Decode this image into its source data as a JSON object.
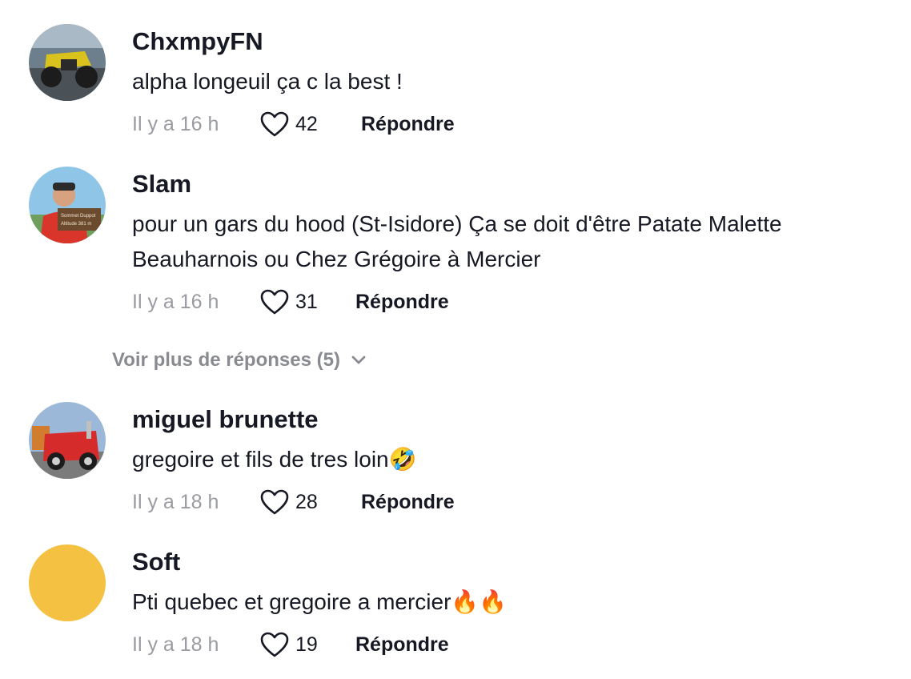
{
  "comments": [
    {
      "username": "ChxmpyFN",
      "text": "alpha longeuil ça c la best !",
      "time": "Il y a 16 h",
      "likes": "42",
      "reply": "Répondre",
      "avatar_color": "#5a6a78"
    },
    {
      "username": "Slam",
      "text": "pour un gars du hood (St-Isidore) Ça se doit d'être Patate Malette Beauharnois ou Chez Grégoire à Mercier",
      "time": "Il y a 16 h",
      "likes": "31",
      "reply": "Répondre",
      "avatar_color": "#8fc6e8",
      "sign_text": "Sommet Duppot",
      "sign_text2": "Altitude 381 m"
    },
    {
      "username": "miguel brunette",
      "text": "gregoire et fils de tres loin🤣",
      "time": "Il y a 18 h",
      "likes": "28",
      "reply": "Répondre",
      "avatar_color": "#9bb8d8"
    },
    {
      "username": "Soft",
      "text": "Pti quebec et gregoire a mercier🔥🔥",
      "time": "Il y a 18 h",
      "likes": "19",
      "reply": "Répondre",
      "avatar_color": "#f4c142"
    }
  ],
  "more_replies": {
    "label": "Voir plus de réponses (5)"
  },
  "colors": {
    "text": "#161823",
    "muted": "#9a9ba0",
    "more": "#8a8b91"
  }
}
